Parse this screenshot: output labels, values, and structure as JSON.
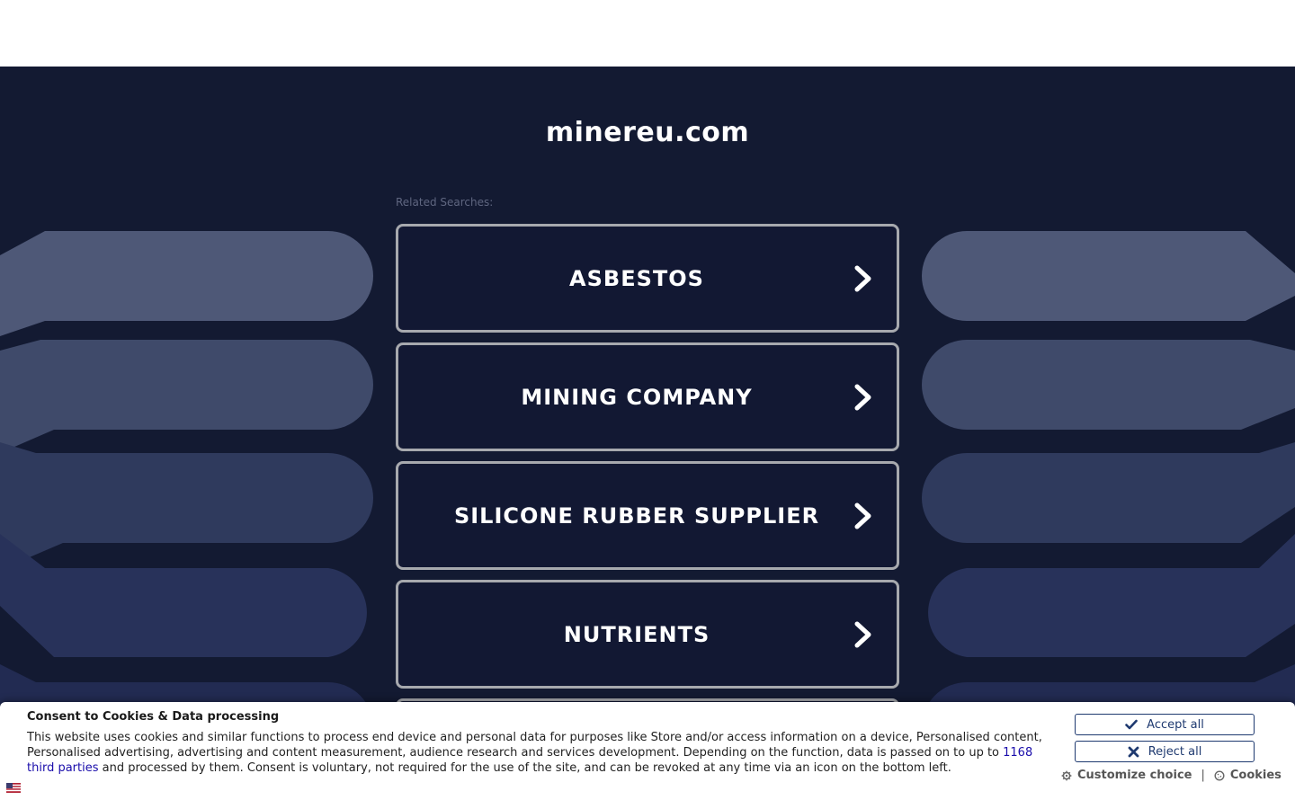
{
  "page": {
    "domain_title": "minereu.com",
    "related_label": "Related Searches:"
  },
  "searches": [
    {
      "label": "ASBESTOS"
    },
    {
      "label": "MINING COMPANY"
    },
    {
      "label": "SILICONE RUBBER SUPPLIER"
    },
    {
      "label": "NUTRIENTS"
    }
  ],
  "consent": {
    "title": "Consent to Cookies & Data processing",
    "text_before_link": "This website uses cookies and similar functions to process end device and personal data for purposes like Store and/or access information on a device, Personalised content, Personalised advertising, advertising and content measurement, audience research and services development. Depending on the function, data is passed on to up to ",
    "link_text": "1168 third parties",
    "text_after_link": " and processed by them. Consent is voluntary, not required for the use of the site, and can be revoked at any time via an icon on the bottom left.",
    "accept_label": "Accept all",
    "reject_label": "Reject all",
    "customize_label": "Customize choice",
    "cookies_label": "Cookies",
    "separator": "|",
    "language_icon": "us-flag-icon"
  },
  "colors": {
    "background": "#131a32",
    "button_border": "#a7a9ae",
    "consent_button": "#1f3a70",
    "link": "#1a0dab"
  }
}
